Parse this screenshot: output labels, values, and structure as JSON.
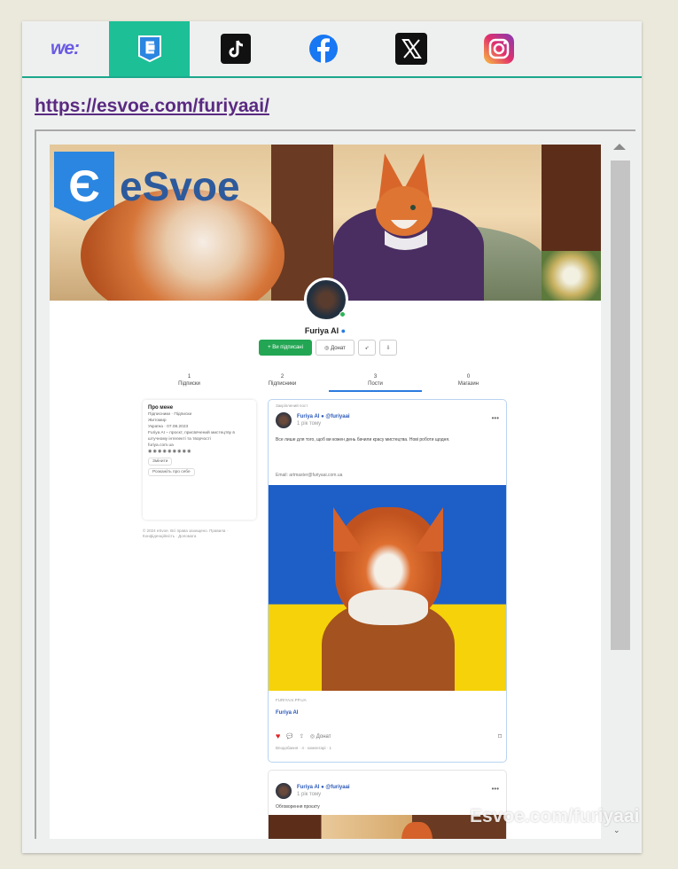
{
  "tabs": {
    "brand": "we:",
    "items": [
      {
        "name": "esvoe",
        "active": true
      },
      {
        "name": "tiktok",
        "active": false
      },
      {
        "name": "facebook",
        "active": false
      },
      {
        "name": "x",
        "active": false
      },
      {
        "name": "instagram",
        "active": false
      }
    ]
  },
  "link": {
    "url": "https://esvoe.com/furiyaai/"
  },
  "profile": {
    "logo_letter": "Є",
    "logo_text": "eSvoe",
    "name": "Furiya AI",
    "verified_mark": "●",
    "actions": {
      "subscribe": "+ Ви підписані",
      "donate": "◎ Донат",
      "share": "➶",
      "more": "⇩"
    },
    "stats": [
      {
        "count": "1",
        "label": "Підписки"
      },
      {
        "count": "2",
        "label": "Підписники"
      },
      {
        "count": "3",
        "label": "Пости"
      },
      {
        "count": "0",
        "label": "Магазин"
      }
    ],
    "about": {
      "title": "Про мене",
      "lines": [
        "Підписники · Підписки",
        "Житомир",
        "Україна · 07.08.2023",
        "Furiya AI – проєкт, присвячений мистецтву в штучному інтелекті та творчості"
      ],
      "site": "furiya.com.ua",
      "social_icons": "◉ ◉ ◉ ◉ ◉ ◉ ◉ ◉ ◉",
      "chip_edit": "Змінити",
      "chip_tell": "Розкажіть про себе"
    },
    "footer": "© 2024 eSvoe. Всі права захищено. Правила · Конфіденційність · Допомога"
  },
  "posts": [
    {
      "pinned": "Закріплений пост",
      "author": "Furiya AI ● @furiyaai",
      "time": "1 рік тому",
      "body": "Все лише для того, щоб ви кожен день бачили красу мистецтва. Нові роботи щодня.",
      "email": "Email: artmaster@furiyaai.com.ua",
      "source": "FURIYAAI.PP.UA",
      "title": "Furiya AI",
      "comment": "💬",
      "share": "⇪",
      "donate": "◎ Донат",
      "bookmark": "⌑",
      "likes": "Вподобання · 4 · коментарі · 1"
    },
    {
      "author": "Furiya AI ● @furiyaai",
      "time": "1 рік тому",
      "caption": "Обговорення проєкту"
    }
  ],
  "watermark": "Esvoe.com/furiyaai",
  "colors": {
    "accent": "#1dbf97",
    "link": "#5a2a82",
    "primary": "#2a7be0",
    "subscribe": "#22a653"
  }
}
